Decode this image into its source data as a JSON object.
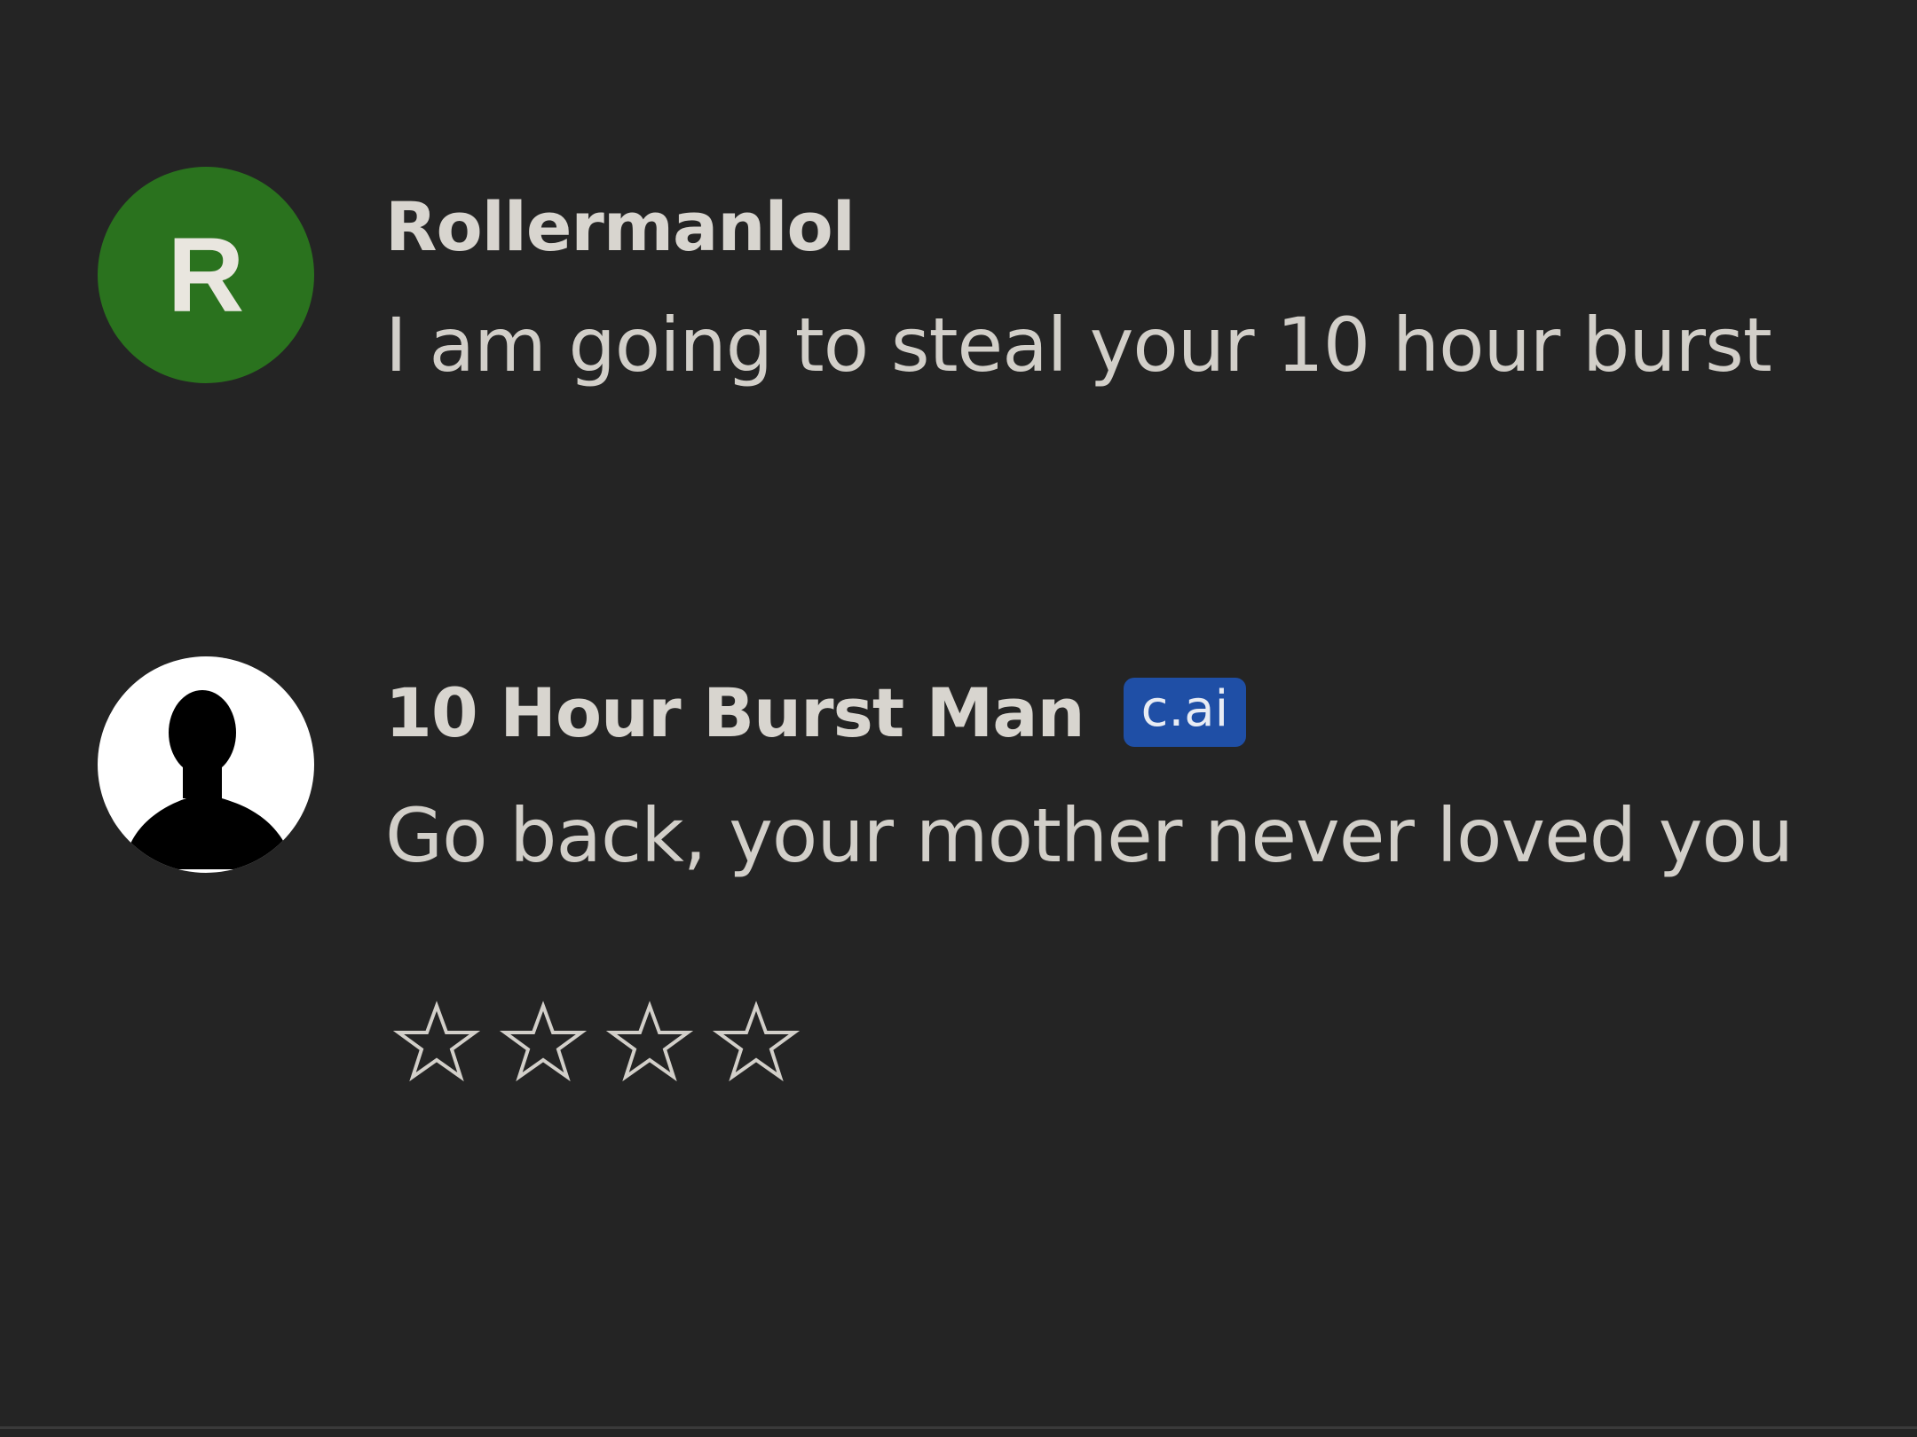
{
  "messages": [
    {
      "avatar_letter": "R",
      "author": "Rollermanlol",
      "text": "I am going to steal your 10 hour burst"
    },
    {
      "author": "10 Hour Burst Man",
      "badge": "c.ai",
      "text": "Go back, your mother never loved you"
    }
  ],
  "rating": {
    "filled": 0,
    "max": 4
  },
  "colors": {
    "background": "#242424",
    "avatar_green": "#2a721e",
    "badge_blue": "#1f4fa6",
    "text": "#d2cfc9"
  }
}
